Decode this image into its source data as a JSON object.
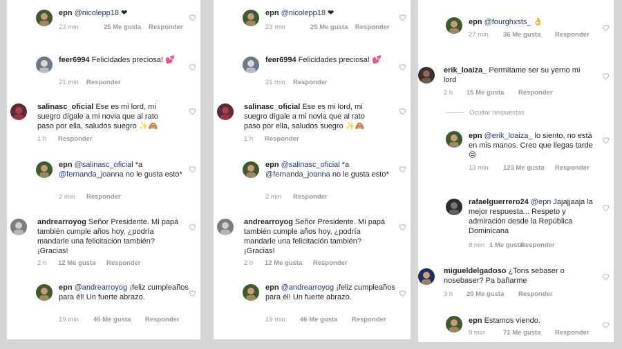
{
  "panel1": {
    "comments": [
      {
        "user": "epn",
        "mention": "@nicolepp18",
        "text": "",
        "emoji": "❤",
        "time": "23 min",
        "likes": "25 Me gusta",
        "reply": "Responder"
      },
      {
        "user": "feer6994",
        "mention": "",
        "text": "Felicidades preciosa!",
        "emoji": "💕",
        "time": "21 min",
        "likes": "",
        "reply": "Responder"
      },
      {
        "user": "salinasc_oficial",
        "mention": "",
        "text": "Ese es mi lord, mi suegro dígale a mi novia que al rato paso por ella, saludos suegro",
        "emoji": "✨🙈",
        "time": "1 h",
        "likes": "",
        "reply": "Responder"
      },
      {
        "user": "epn",
        "mention": "@salinasc_oficial",
        "text": "*a",
        "mention2": "@fernanda_joanna",
        "text2": "no le gusta esto*",
        "time": "2 min",
        "likes": "",
        "reply": "Responder"
      },
      {
        "user": "andrearroyog",
        "mention": "",
        "text": "Señor Presidente. Mi papá también cumple años hoy, ¿podría mandarle una felicitación también? ¡Gracias!",
        "time": "2 h",
        "likes": "12 Me gusta",
        "reply": "Responder"
      },
      {
        "user": "epn",
        "mention": "@andrearroyog",
        "text": "¡feliz cumpleaños para él! Un fuerte abrazo.",
        "time": "19 min",
        "likes": "46 Me gusta",
        "reply": "Responder"
      }
    ]
  },
  "panel2": {
    "comments": [
      {
        "user": "epn",
        "mention": "@nicolepp18",
        "text": "",
        "emoji": "❤",
        "time": "23 min",
        "likes": "25 Me gusta",
        "reply": "Responder"
      },
      {
        "user": "feer6994",
        "mention": "",
        "text": "Felicidades preciosa!",
        "emoji": "💕",
        "time": "21 min",
        "likes": "",
        "reply": "Responder"
      },
      {
        "user": "salinasc_oficial",
        "mention": "",
        "text": "Ese es mi lord, mi suegro dígale a mi novia que al rato paso por ella, saludos suegro",
        "emoji": "✨🙈",
        "time": "1 h",
        "likes": "",
        "reply": "Responder"
      },
      {
        "user": "epn",
        "mention": "@salinasc_oficial",
        "text": "*a",
        "mention2": "@fernanda_joanna",
        "text2": "no le gusta esto*",
        "time": "2 min",
        "likes": "",
        "reply": "Responder"
      },
      {
        "user": "andrearroyog",
        "mention": "",
        "text": "Señor Presidente. Mi papá también cumple años hoy, ¿podría mandarle una felicitación también? ¡Gracias!",
        "time": "2 h",
        "likes": "12 Me gusta",
        "reply": "Responder"
      },
      {
        "user": "epn",
        "mention": "@andrearroyog",
        "text": "¡feliz cumpleaños para él! Un fuerte abrazo.",
        "time": "19 min",
        "likes": "46 Me gusta",
        "reply": "Responder"
      }
    ]
  },
  "panel3": {
    "hide_replies": "Ocultar respuestas",
    "comments": [
      {
        "user": "epn",
        "mention": "@fourghxsts_",
        "text": "",
        "emoji": "👌",
        "time": "27 min",
        "likes": "36 Me gusta",
        "reply": "Responder"
      },
      {
        "user": "erik_loaiza_",
        "mention": "",
        "text": "Permítame ser su yerno mi lord",
        "time": "2 h",
        "likes": "15 Me gusta",
        "reply": "Responder"
      },
      {
        "user": "epn",
        "mention": "@erik_loaiza_",
        "text": "lo siento, no está en mis manos. Creo que llegas tarde",
        "emoji": "😔",
        "time": "13 min",
        "likes": "123 Me gusta",
        "reply": "Responder"
      },
      {
        "user": "rafaelguerrero24",
        "mention": "@epn",
        "text": "Jajajjaaja la mejor respuesta... Respeto y admiración desde la República Dominicana",
        "time": "8 min",
        "likes": "1 Me gusta",
        "reply": "Responder"
      },
      {
        "user": "migueldelgadoso",
        "mention": "",
        "text": "¿Tons sebaser o nosebaser? Pa bañarme",
        "time": "3 h",
        "likes": "20 Me gusta",
        "reply": "Responder"
      },
      {
        "user": "epn",
        "mention": "",
        "text": "Estamos viendo.",
        "time": "9 min",
        "likes": "71 Me gusta",
        "reply": "Responder"
      }
    ]
  }
}
